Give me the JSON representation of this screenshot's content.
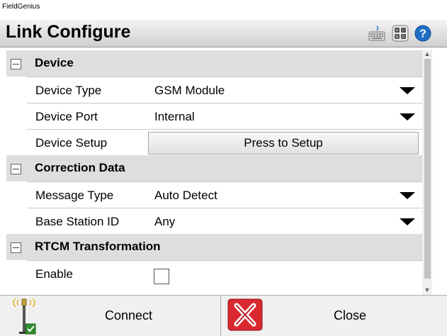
{
  "app": {
    "caption": "FieldGenius"
  },
  "header": {
    "title": "Link Configure",
    "icons": [
      "keyboard-icon",
      "calculator-icon",
      "help-icon"
    ]
  },
  "sections": [
    {
      "label": "Device",
      "rows": [
        {
          "name": "Device Type",
          "value": "GSM Module",
          "control": "dropdown"
        },
        {
          "name": "Device Port",
          "value": "Internal",
          "control": "dropdown"
        },
        {
          "name": "Device Setup",
          "value": "Press to Setup",
          "control": "button"
        }
      ]
    },
    {
      "label": "Correction Data",
      "rows": [
        {
          "name": "Message Type",
          "value": "Auto Detect",
          "control": "dropdown"
        },
        {
          "name": "Base Station ID",
          "value": "Any",
          "control": "dropdown"
        }
      ]
    },
    {
      "label": "RTCM Transformation",
      "rows": [
        {
          "name": "Enable",
          "value": "",
          "control": "checkbox",
          "checked": false
        }
      ]
    }
  ],
  "footer": {
    "connect_label": "Connect",
    "close_label": "Close"
  },
  "colors": {
    "section_bg": "#dedede",
    "close_red": "#d9282f",
    "title_bar": "#dcdcdc"
  }
}
